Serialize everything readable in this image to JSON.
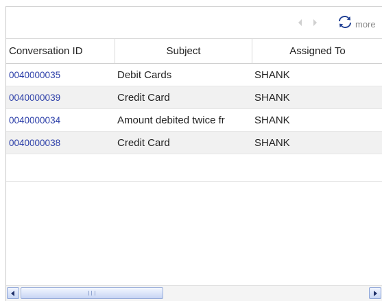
{
  "toolbar": {
    "more_label": "more",
    "prev_icon": "chevron-left-icon",
    "next_icon": "chevron-right-icon",
    "refresh_icon": "refresh-icon"
  },
  "table": {
    "columns": [
      "Conversation ID",
      "Subject",
      "Assigned To"
    ],
    "rows": [
      {
        "id": "0040000035",
        "subject": "Debit Cards",
        "assigned": "SHANK"
      },
      {
        "id": "0040000039",
        "subject": "Credit Card",
        "assigned": "SHANK"
      },
      {
        "id": "0040000034",
        "subject": "Amount debited twice fr",
        "assigned": "SHANK"
      },
      {
        "id": "0040000038",
        "subject": "Credit Card",
        "assigned": "SHANK"
      }
    ]
  },
  "colors": {
    "link": "#2b3ea8",
    "alt_row": "#f1f1f1",
    "refresh_icon": "#1f3f93"
  }
}
